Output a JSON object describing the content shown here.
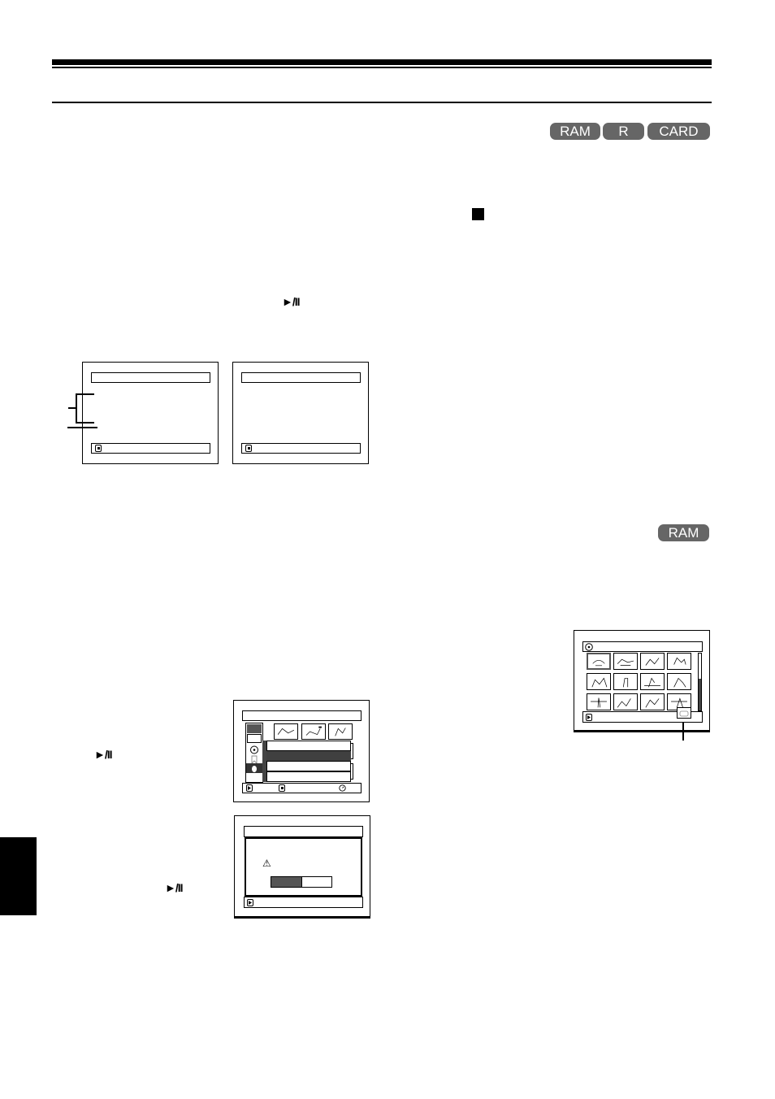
{
  "header": {
    "media_badges": [
      "RAM",
      "R",
      "CARD"
    ]
  },
  "section_badge": "RAM",
  "symbols": {
    "play_pause": "►/II",
    "stop": "■",
    "warning": "⚠",
    "thumb_folder_icon": "folder-icon"
  },
  "dialog": {
    "selected_option_fraction": 0.5
  },
  "thumbnail_screen": {
    "rows": 3,
    "cols": 4,
    "selected_index": 0,
    "scroll_fraction": 0.55
  },
  "colors": {
    "badge_bg": "#666666",
    "badge_text": "#ffffff",
    "highlight": "#404040"
  }
}
